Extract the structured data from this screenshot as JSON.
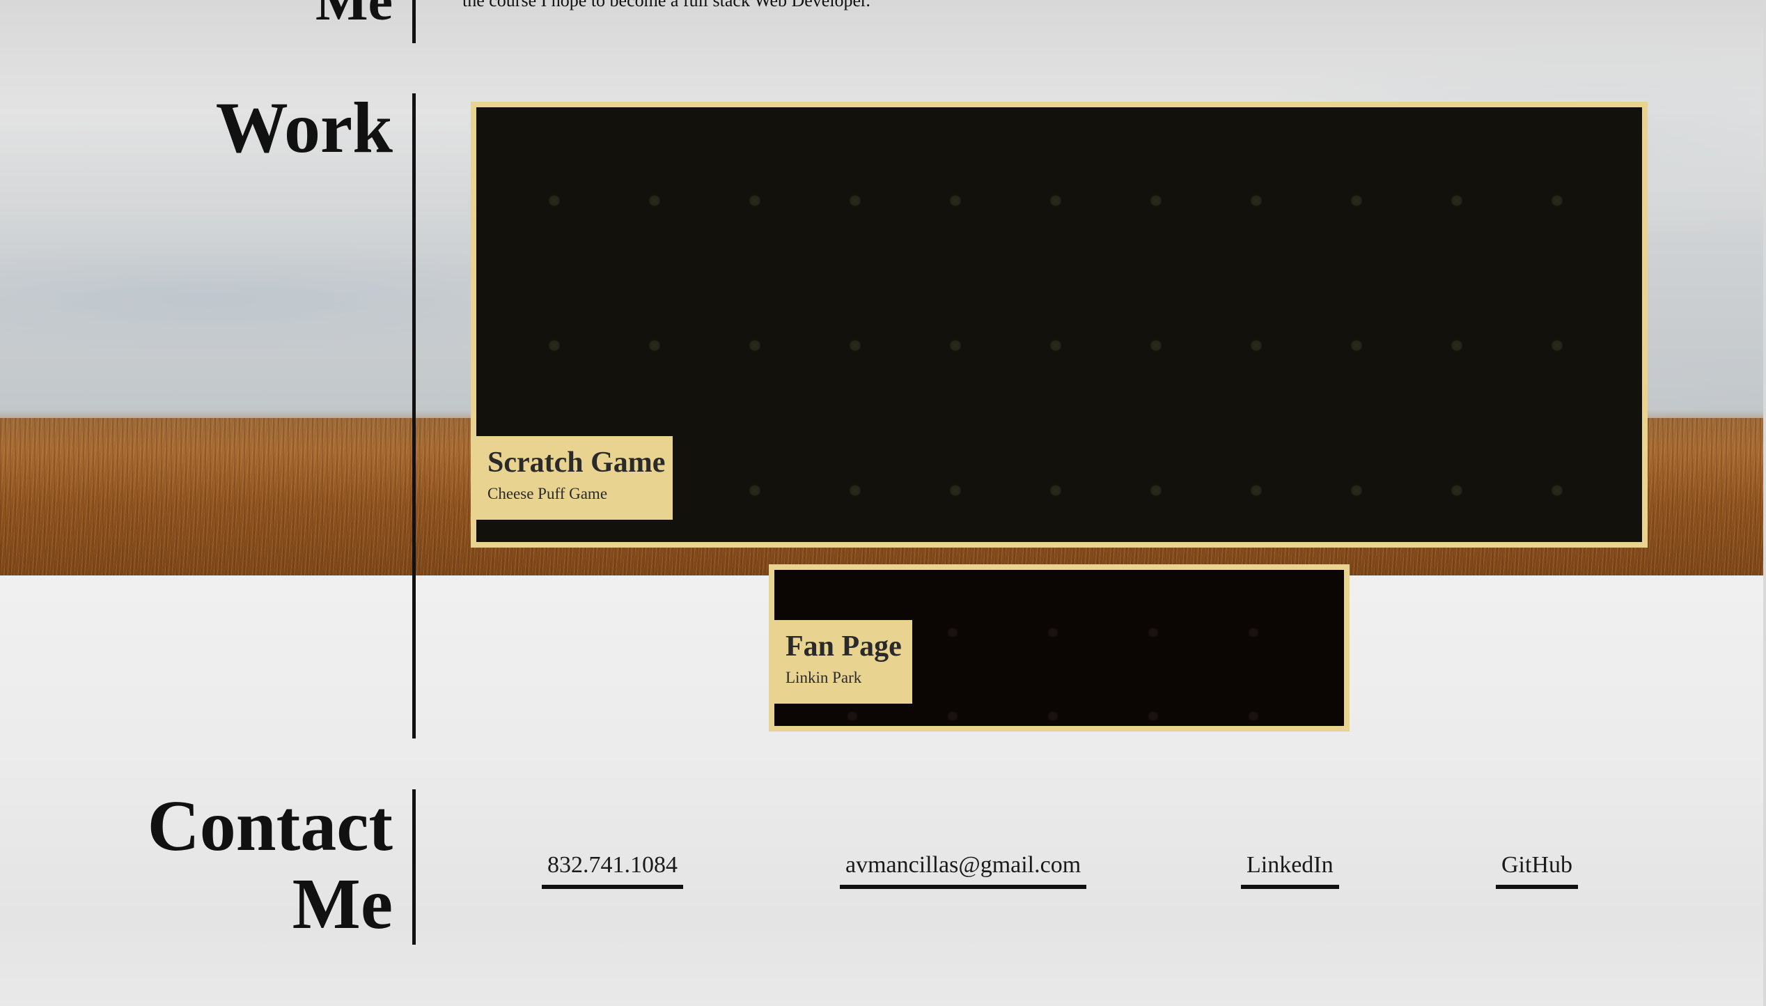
{
  "about": {
    "title_partial": "Me",
    "text_partial": "the course I hope to become a full stack Web Developer."
  },
  "work": {
    "title": "Work",
    "projects": [
      {
        "name": "Scratch Game",
        "subtitle": "Cheese Puff Game"
      },
      {
        "name": "Fan Page",
        "subtitle": "Linkin Park"
      }
    ],
    "accent_color": "#e8d391"
  },
  "contact": {
    "title_line1": "Contact",
    "title_line2": "Me",
    "links": {
      "phone": "832.741.1084",
      "email": "avmancillas@gmail.com",
      "linkedin": "LinkedIn",
      "github": "GitHub"
    }
  }
}
